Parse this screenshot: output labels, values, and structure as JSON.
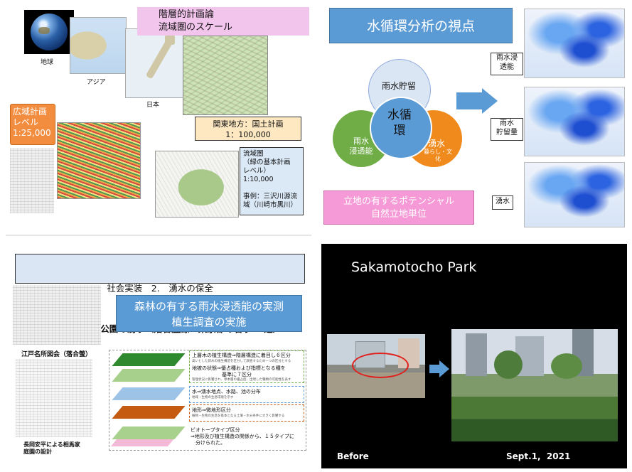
{
  "q1": {
    "banner": "階層的計画論\n流域圏のスケール",
    "earth_label": "地球",
    "asia_label": "アジア",
    "japan_label": "日本",
    "kanto_box": "関東地方：国土計画\n1：100,000",
    "wide_box": "広域計画\nレベル\n1:25,000",
    "basin_box": "流域圏\n（緑の基本計画\nレベル）\n1:10,000\n\n事例：三沢川源流\n域（川崎市黒川）"
  },
  "q2": {
    "title": "水循環分析の視点",
    "circle_top": "雨水貯留",
    "circle_center": "水循\n環",
    "circle_left": "雨水\n浸透能",
    "circle_right_big": "湧水",
    "circle_right_small": "暮らし・文\n化",
    "potential_box": "立地の有するポテンシャル\n自然立地単位",
    "label_infiltration": "雨水浸\n透能",
    "label_storage": "雨水\n貯留量",
    "label_spring": "湧水"
  },
  "q3": {
    "title_line1": "社会実装　2.　湧水の保全",
    "title_line2": "新宿区おとめ山公園の湧水（落合崖線　東京都の名水57選）",
    "blue_box": "森林の有する雨水浸透能の実測\n植生調査の実施",
    "edo_caption": "江戸名所図会（落合螢）",
    "garden_caption": "長岡安平による相馬家\n庭園の設計",
    "layer1_title": "上層木の植生構造⇒階層構造に着目し６区分",
    "layer1_sub": "高いとした新木の植生構造を区分して調査するため一つの区分とする",
    "layer2_title": "地被の状態⇒優占種および指標となる種を\n　　　　　　基準に７区分",
    "layer2_sub": "管理状況に影響され、草本層の優占度、出現した種類の可能性を表す",
    "layer3_title": "水⇒湧水地点、水路、池の分布",
    "layer3_sub": "地域・生物の生息環境を示す",
    "layer4_title": "地形⇒微地形区分",
    "layer4_sub": "植物・生物の生息を基本となる土壌・水分条件に大きく影響する",
    "layer5_title": "ビオトープタイプ区分\n⇒地形及び植生構造の関係から、１５タイプに\n　分けられた。"
  },
  "q4": {
    "title": "Sakamotocho Park",
    "before_label": "Before",
    "after_label": "Sept.1,  2021"
  }
}
